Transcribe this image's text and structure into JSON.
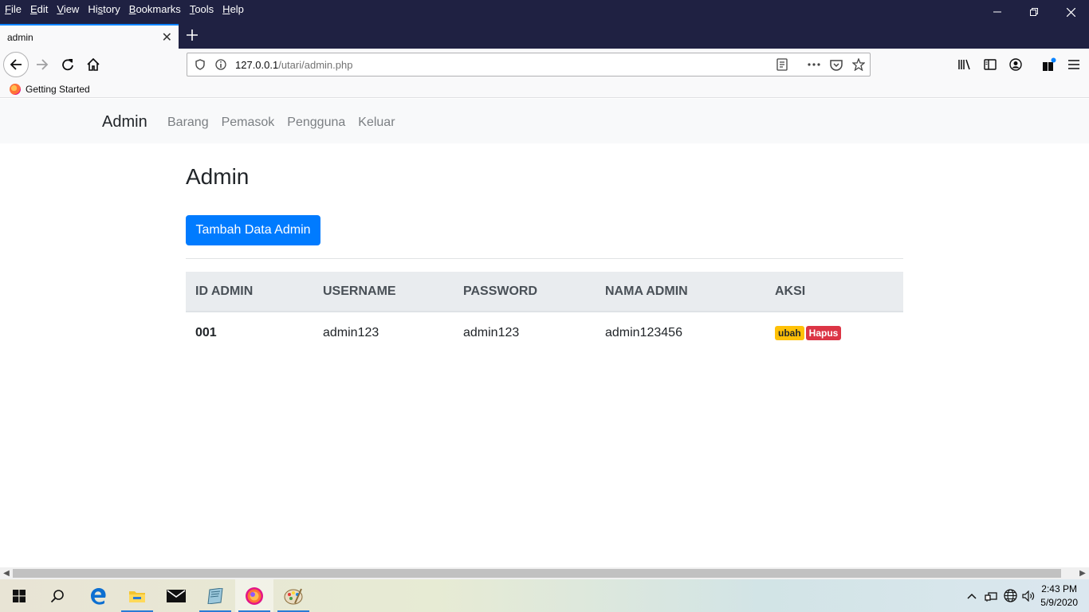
{
  "menu": [
    "File",
    "Edit",
    "View",
    "History",
    "Bookmarks",
    "Tools",
    "Help"
  ],
  "tab": {
    "title": "admin"
  },
  "url": {
    "host": "127.0.0.1",
    "path": "/utari/admin.php"
  },
  "bookmarks": [
    {
      "label": "Getting Started"
    }
  ],
  "site_nav": {
    "brand": "Admin",
    "links": [
      "Barang",
      "Pemasok",
      "Pengguna",
      "Keluar"
    ]
  },
  "page": {
    "title": "Admin",
    "add_button": "Tambah Data Admin"
  },
  "table": {
    "headers": [
      "ID ADMIN",
      "USERNAME",
      "PASSWORD",
      "NAMA ADMIN",
      "AKSI"
    ],
    "rows": [
      {
        "id": "001",
        "username": "admin123",
        "password": "admin123",
        "nama": "admin123456",
        "edit": "ubah",
        "delete": "Hapus"
      }
    ]
  },
  "colors": {
    "primary": "#007bff",
    "warning": "#ffc107",
    "danger": "#dc3545",
    "titlebar": "#1f2142"
  },
  "taskbar": {
    "items": [
      "windows-start-icon",
      "search-icon",
      "edge-icon",
      "file-explorer-icon",
      "mail-icon",
      "notepad-icon",
      "firefox-icon",
      "paint-icon"
    ],
    "time": "2:43 PM",
    "date": "5/9/2020"
  }
}
